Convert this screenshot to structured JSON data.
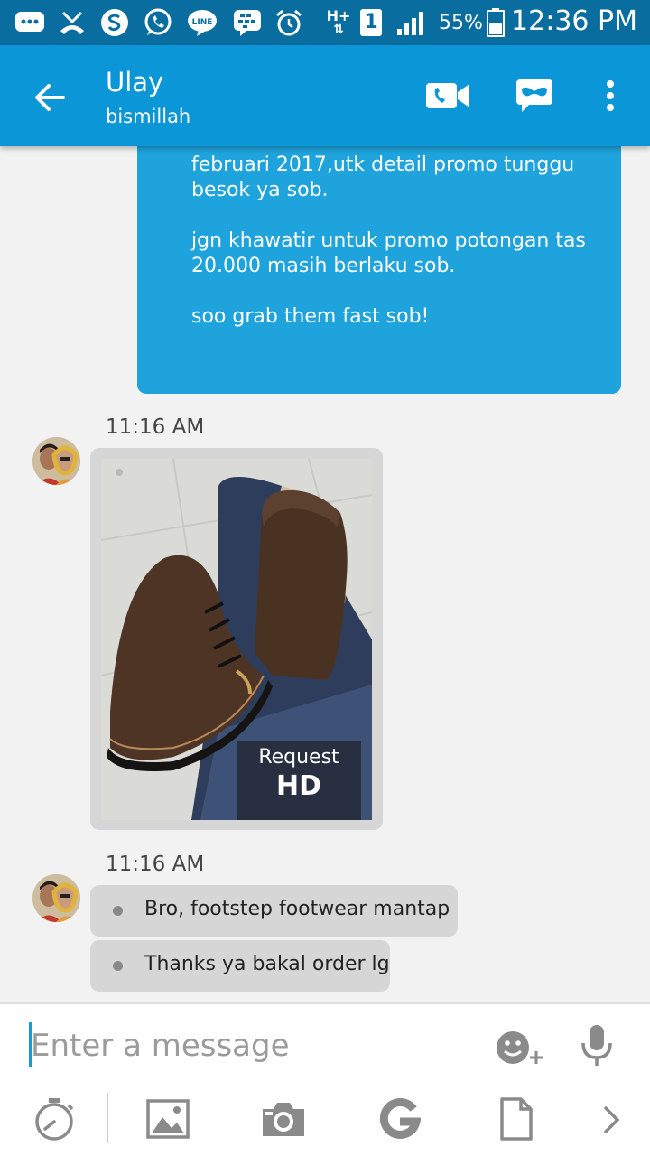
{
  "status_bar": {
    "battery_percent": "55%",
    "time": "12:36 PM",
    "network_type": "H+",
    "sim_slot": "1",
    "icons": [
      "messages-icon",
      "missed-call-icon",
      "skype-icon",
      "whatsapp-icon",
      "line-icon",
      "bbm-icon",
      "alarm-icon",
      "network-icon",
      "sim-icon",
      "signal-icon",
      "battery-icon"
    ]
  },
  "header": {
    "title": "Ulay",
    "subtitle": "bismillah",
    "icons": [
      "back-arrow-icon",
      "video-call-icon",
      "chat-mask-icon",
      "more-icon"
    ]
  },
  "messages": {
    "outgoing": {
      "lines": [
        "februari 2017,utk detail promo tunggu",
        "besok ya sob.",
        "jgn khawatir untuk promo potongan tas",
        "20.000 masih berlaku sob.",
        "soo grab them fast sob!"
      ]
    },
    "group1": {
      "time": "11:16 AM",
      "hd_request_top": "Request",
      "hd_request_bottom": "HD"
    },
    "group2": {
      "time": "11:16 AM",
      "items": [
        "Bro, footstep footwear mantap",
        "Thanks ya bakal order lg"
      ]
    }
  },
  "composer": {
    "placeholder": "Enter a message",
    "icons": [
      "emoji-add-icon",
      "mic-icon",
      "timer-icon",
      "gallery-icon",
      "camera-icon",
      "google-icon",
      "file-icon",
      "chevron-right-icon"
    ]
  },
  "colors": {
    "status_bar": "#0a6d9f",
    "app_bar": "#0a96d7",
    "outgoing_bubble": "#1ea3dc",
    "incoming_bubble": "#d6d6d6",
    "background": "#f2f2f2"
  }
}
